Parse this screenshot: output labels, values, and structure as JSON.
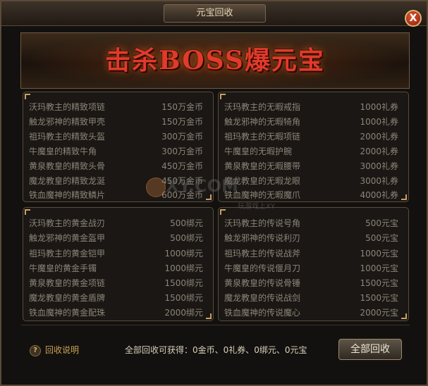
{
  "window": {
    "title": "元宝回收",
    "close_label": "X"
  },
  "banner": {
    "text": "击杀BOSS爆元宝"
  },
  "panels": {
    "gold": {
      "items": [
        {
          "name": "沃玛教主的精致项链",
          "price": "150万金币"
        },
        {
          "name": "触龙邪神的精致甲壳",
          "price": "150万金币"
        },
        {
          "name": "祖玛教主的精致头盔",
          "price": "300万金币"
        },
        {
          "name": "牛魔皇的精致牛角",
          "price": "300万金币"
        },
        {
          "name": "黄泉教皇的精致头骨",
          "price": "450万金币"
        },
        {
          "name": "魔龙教皇的精致龙涎",
          "price": "450万金币"
        },
        {
          "name": "铁血魔神的精致鳞片",
          "price": "600万金币"
        }
      ]
    },
    "coupon": {
      "items": [
        {
          "name": "沃玛教主的无暇戒指",
          "price": "1000礼券"
        },
        {
          "name": "触龙邪神的无暇犄角",
          "price": "1000礼券"
        },
        {
          "name": "祖玛教主的无暇项链",
          "price": "2000礼券"
        },
        {
          "name": "牛魔皇的无暇护腕",
          "price": "2000礼券"
        },
        {
          "name": "黄泉教皇的无暇腰带",
          "price": "3000礼券"
        },
        {
          "name": "魔龙教皇的无暇龙眼",
          "price": "3000礼券"
        },
        {
          "name": "铁血魔神的无暇魔爪",
          "price": "4000礼券"
        }
      ]
    },
    "bound": {
      "items": [
        {
          "name": "沃玛教主的黄金战刃",
          "price": "500绑元"
        },
        {
          "name": "触龙邪神的黄金盔甲",
          "price": "500绑元"
        },
        {
          "name": "祖玛教主的黄金铠甲",
          "price": "1000绑元"
        },
        {
          "name": "牛魔皇的黄金手镯",
          "price": "1000绑元"
        },
        {
          "name": "黄泉教皇的黄金项链",
          "price": "1500绑元"
        },
        {
          "name": "魔龙教皇的黄金盾牌",
          "price": "1500绑元"
        },
        {
          "name": "铁血魔神的黄金配珠",
          "price": "2000绑元"
        }
      ]
    },
    "yuanbao": {
      "items": [
        {
          "name": "沃玛教主的传说号角",
          "price": "500元宝"
        },
        {
          "name": "触龙邪神的传说利刃",
          "price": "500元宝"
        },
        {
          "name": "祖玛教主的传说战斧",
          "price": "1000元宝"
        },
        {
          "name": "牛魔皇的传说偃月刀",
          "price": "1000元宝"
        },
        {
          "name": "黄泉教皇的传说骨锤",
          "price": "1500元宝"
        },
        {
          "name": "魔龙教皇的传说战剑",
          "price": "1500元宝"
        },
        {
          "name": "铁血魔神的传说魔心",
          "price": "2000元宝"
        }
      ]
    }
  },
  "footer": {
    "help_icon": "?",
    "help_label": "回收说明",
    "summary": "全部回收可获得：0金币、0礼券、0绑元、0元宝",
    "reclaim_button": "全部回收"
  },
  "watermark": {
    "main": "XY.COM",
    "sub": "玩游戏上XY"
  },
  "colors": {
    "title_text": "#e8d8b8",
    "banner_text": "#e23a2a",
    "item_text": "#8c8578",
    "help_text": "#c9a453"
  },
  "icons": {
    "close": "close-icon",
    "help": "help-icon"
  }
}
